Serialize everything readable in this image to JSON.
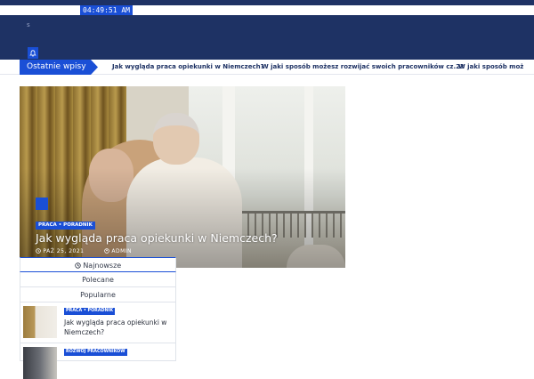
{
  "topbar": {
    "clock": "04:49:51 AM"
  },
  "header": {
    "site_mark": "s"
  },
  "ticker": {
    "label": "Ostatnie wpisy",
    "items": [
      "Jak wygląda praca opiekunki w Niemczech?",
      "W jaki sposób możesz rozwijać swoich pracowników cz.2?",
      "W jaki sposób moż"
    ]
  },
  "hero": {
    "category": "PRACA • PORADNIK",
    "title": "Jak wygląda praca opiekunki w Niemczech?",
    "date": "PAŹ 25, 2021",
    "author": "ADMIN"
  },
  "tabs": [
    {
      "label": "Najnowsze"
    },
    {
      "label": "Polecane"
    },
    {
      "label": "Popularne"
    }
  ],
  "posts": [
    {
      "category": "PRACA • PORADNIK",
      "title": "Jak wygląda praca opiekunki w Niemczech?"
    },
    {
      "category": "ROZWÓJ PRACOWNIKÓW",
      "title": ""
    }
  ],
  "colors": {
    "navy": "#1e3264",
    "accent": "#1a4fd6"
  },
  "icons": [
    "bell-icon",
    "clock-icon",
    "user-icon",
    "calendar-icon"
  ]
}
